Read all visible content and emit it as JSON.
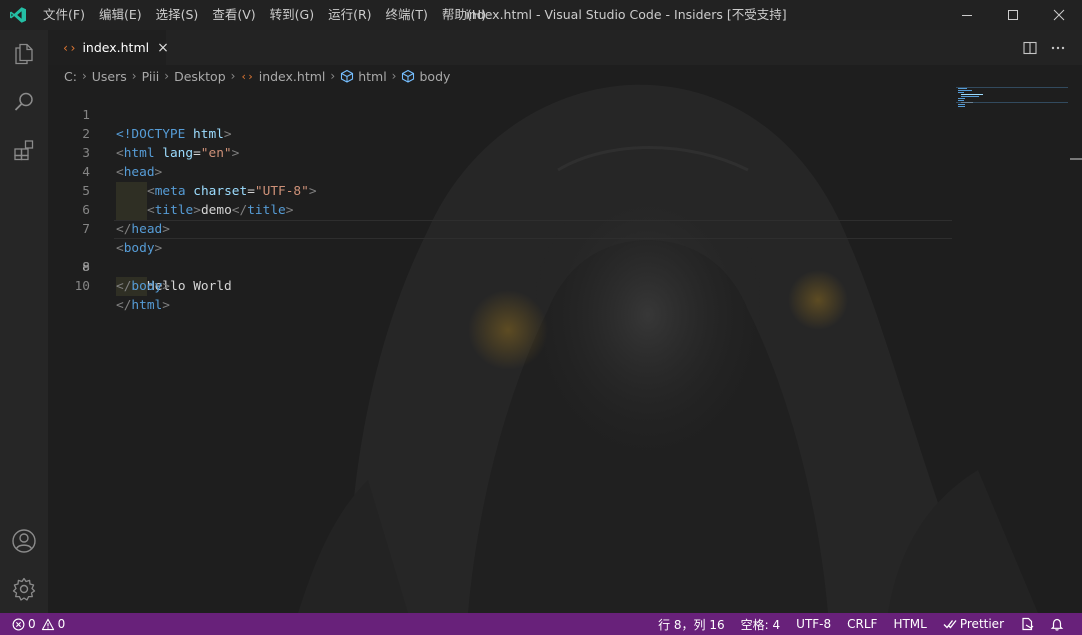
{
  "titlebar": {
    "menus": [
      "文件(F)",
      "编辑(E)",
      "选择(S)",
      "查看(V)",
      "转到(G)",
      "运行(R)",
      "终端(T)",
      "帮助(H)"
    ],
    "window_title": "index.html - Visual Studio Code - Insiders [不受支持]"
  },
  "activitybar": {
    "items": [
      "files-icon",
      "search-icon",
      "extensions-icon"
    ],
    "bottom": [
      "account-icon",
      "gear-icon"
    ]
  },
  "tab": {
    "label": "index.html",
    "close": "×"
  },
  "breadcrumb": {
    "parts": [
      "C:",
      "Users",
      "Piii",
      "Desktop"
    ],
    "file": "index.html",
    "symbols": [
      "html",
      "body"
    ]
  },
  "editor": {
    "active_line": 8,
    "line_numbers": [
      "1",
      "2",
      "3",
      "4",
      "5",
      "6",
      "7",
      "8",
      "9",
      "10"
    ],
    "tokens": {
      "l1a": "<!DOCTYPE",
      "l1b": " html",
      "l1c": ">",
      "l2a": "<",
      "l2b": "html",
      "l2c": " lang",
      "l2d": "=",
      "l2e": "\"en\"",
      "l2f": ">",
      "l3a": "<",
      "l3b": "head",
      "l3c": ">",
      "l4a": "<",
      "l4b": "meta",
      "l4c": " charset",
      "l4d": "=",
      "l4e": "\"UTF-8\"",
      "l4f": ">",
      "l5a": "<",
      "l5b": "title",
      "l5c": ">",
      "l5d": "demo",
      "l5e": "</",
      "l5f": "title",
      "l5g": ">",
      "l6a": "</",
      "l6b": "head",
      "l6c": ">",
      "l7a": "<",
      "l7b": "body",
      "l7c": ">",
      "l8a": "Hello World",
      "l9a": "</",
      "l9b": "body",
      "l9c": ">",
      "l10a": "</",
      "l10b": "html",
      "l10c": ">"
    }
  },
  "statusbar": {
    "errors": "0",
    "warnings": "0",
    "cursor": "行 8，列 16",
    "indent": "空格: 4",
    "encoding": "UTF-8",
    "eol": "CRLF",
    "language": "HTML",
    "formatter": "Prettier"
  },
  "colors": {
    "statusbar": "#68217a",
    "tag": "#569cd6",
    "attribute": "#9cdcfe",
    "string": "#ce9178",
    "tab_icon": "#e37933",
    "logo": "#24bfa5"
  }
}
